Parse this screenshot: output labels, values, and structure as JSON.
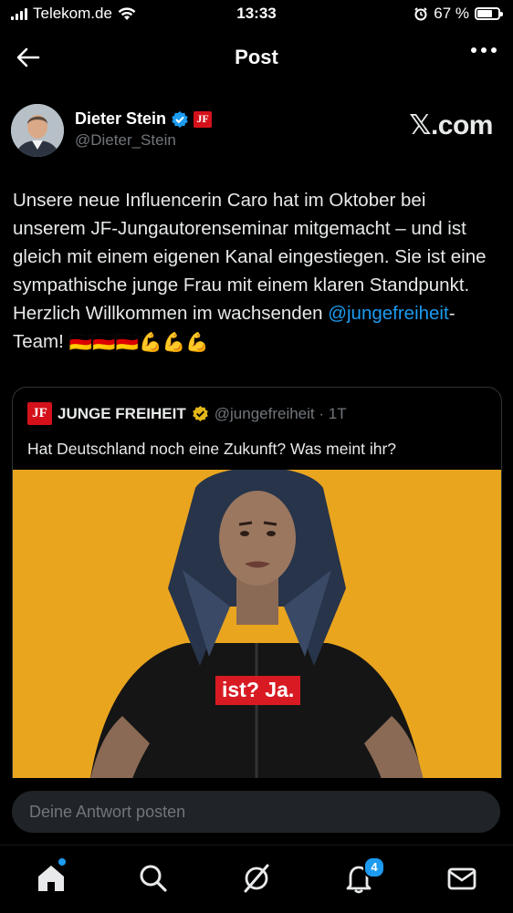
{
  "status_bar": {
    "carrier": "Telekom.de",
    "time": "13:33",
    "battery": "67 %",
    "battery_level": 0.67
  },
  "header": {
    "title": "Post"
  },
  "author": {
    "name": "Dieter Stein",
    "badge": "JF",
    "handle": "@Dieter_Stein",
    "source": "𝕏.com"
  },
  "post": {
    "text": "Unsere neue Influencerin Caro hat im Oktober bei unserem JF-Jungautorenseminar mitgemacht – und ist gleich mit einem eigenen Kanal eingestiegen. Sie ist eine sympathische junge Frau mit einem klaren Standpunkt. Herzlich Willkommen im wachsenden ",
    "mention": "@jungefreiheit",
    "text_after": "-Team! ",
    "emojis": "🇩🇪🇩🇪🇩🇪💪💪💪"
  },
  "quote": {
    "logo": "JF",
    "name": "JUNGE FREIHEIT",
    "handle": "@jungefreiheit · 1T",
    "text": "Hat Deutschland noch eine Zukunft? Was meint ihr?",
    "caption": "ist? Ja."
  },
  "reply": {
    "placeholder": "Deine Antwort posten"
  },
  "tabbar": {
    "notification_count": "4"
  },
  "colors": {
    "accent": "#1d9bf0",
    "background": "#000000",
    "jf_red": "#d4111b",
    "media_bg": "#eaa51f"
  },
  "icons": [
    "back-arrow-icon",
    "more-icon",
    "verified-icon",
    "home-icon",
    "search-icon",
    "grok-icon",
    "bell-icon",
    "mail-icon"
  ]
}
